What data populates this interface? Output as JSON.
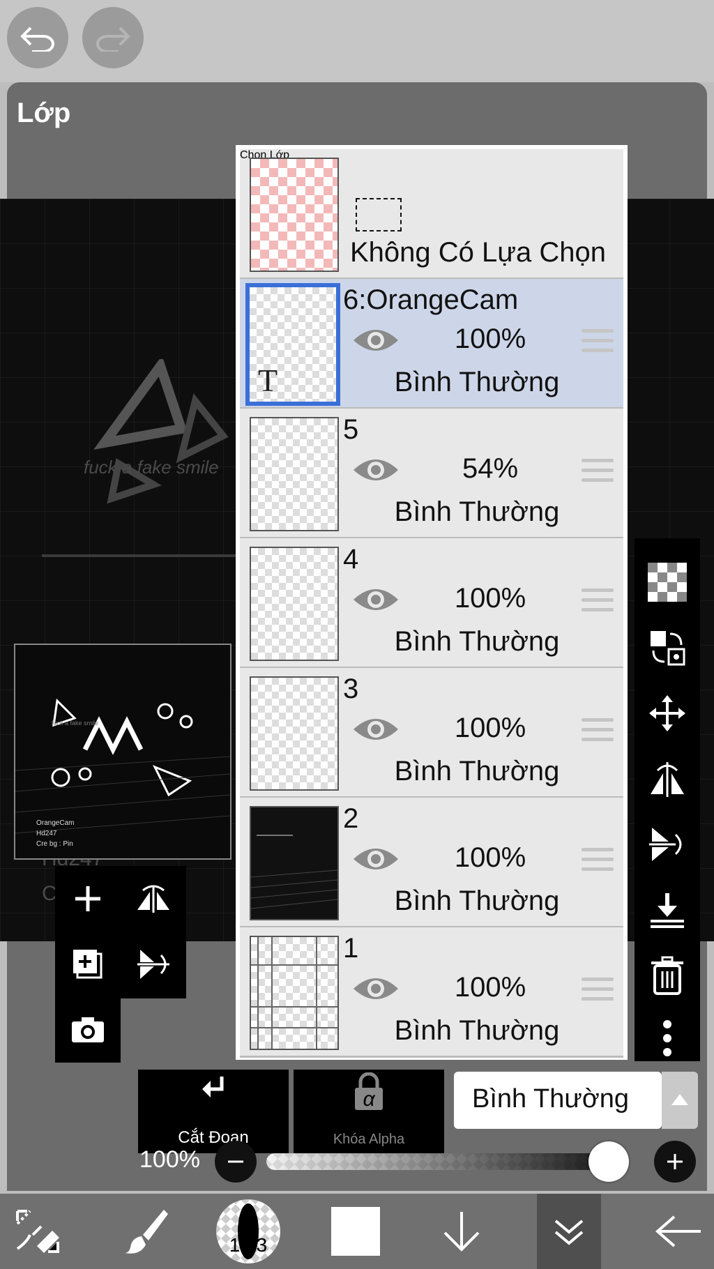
{
  "app": {
    "panel_title": "Lớp"
  },
  "top_toolbar": {
    "undo_icon": "undo-icon",
    "redo_icon": "redo-icon"
  },
  "canvas": {
    "ghost_text": "fuck a fake smile",
    "ghost_lines": [
      "Hd247",
      "C"
    ]
  },
  "preview": {
    "caption_small": "fuck a fake smile",
    "lines": [
      "OrangeCam",
      "Hd247",
      "Cre bg : Pin"
    ]
  },
  "selection_layer": {
    "title": "Chọn Lớp",
    "status": "Không Có Lựa Chọn"
  },
  "layers": [
    {
      "name": "6:OrangeCam",
      "opacity": "100%",
      "blend": "Bình Thường",
      "selected": true,
      "thumb_text": "T"
    },
    {
      "name": "5",
      "opacity": "54%",
      "blend": "Bình Thường",
      "selected": false
    },
    {
      "name": "4",
      "opacity": "100%",
      "blend": "Bình Thường",
      "selected": false
    },
    {
      "name": "3",
      "opacity": "100%",
      "blend": "Bình Thường",
      "selected": false
    },
    {
      "name": "2",
      "opacity": "100%",
      "blend": "Bình Thường",
      "selected": false
    },
    {
      "name": "1",
      "opacity": "100%",
      "blend": "Bình Thường",
      "selected": false
    }
  ],
  "actions": {
    "clip_label": "Cắt Đoạn",
    "alpha_lock_label": "Khóa Alpha",
    "alpha_lock_symbol": "α",
    "blend_mode": "Bình Thường"
  },
  "opacity_control": {
    "label": "100%",
    "value": 1.0
  },
  "bottom_bar": {
    "brush_size": "16.3"
  },
  "colors": {
    "accent": "#3a6fd8",
    "panel": "#6c6c6c",
    "selected_row": "#cdd6e8"
  }
}
